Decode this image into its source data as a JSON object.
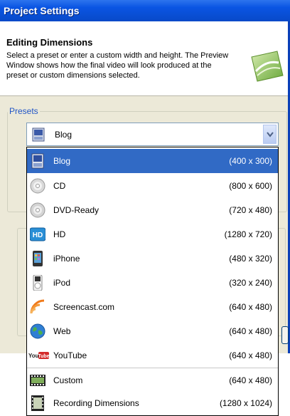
{
  "window": {
    "title": "Project Settings"
  },
  "header": {
    "title": "Editing Dimensions",
    "description": "Select a preset or enter a custom width and height. The Preview Window shows how the final video will look produced at the preset or custom dimensions selected."
  },
  "presets": {
    "group_label": "Presets",
    "selected": "Blog",
    "items": [
      {
        "name": "Blog",
        "dims": "(400 x 300)",
        "icon": "blog-icon"
      },
      {
        "name": "CD",
        "dims": "(800 x 600)",
        "icon": "cd-icon"
      },
      {
        "name": "DVD-Ready",
        "dims": "(720 x 480)",
        "icon": "dvd-icon"
      },
      {
        "name": "HD",
        "dims": "(1280 x 720)",
        "icon": "hd-icon"
      },
      {
        "name": "iPhone",
        "dims": "(480 x 320)",
        "icon": "iphone-icon"
      },
      {
        "name": "iPod",
        "dims": "(320 x 240)",
        "icon": "ipod-icon"
      },
      {
        "name": "Screencast.com",
        "dims": "(640 x 480)",
        "icon": "screencast-icon"
      },
      {
        "name": "Web",
        "dims": "(640 x 480)",
        "icon": "globe-icon"
      },
      {
        "name": "YouTube",
        "dims": "(640 x 480)",
        "icon": "youtube-icon"
      },
      {
        "name": "Custom",
        "dims": "(640 x 480)",
        "icon": "film-strip-icon"
      },
      {
        "name": "Recording Dimensions",
        "dims": "(1280 x 1024)",
        "icon": "film-recording-icon"
      }
    ]
  },
  "colors": {
    "titlebar": "#0a55e3",
    "selection": "#316ac5",
    "group_label": "#2155c6"
  }
}
